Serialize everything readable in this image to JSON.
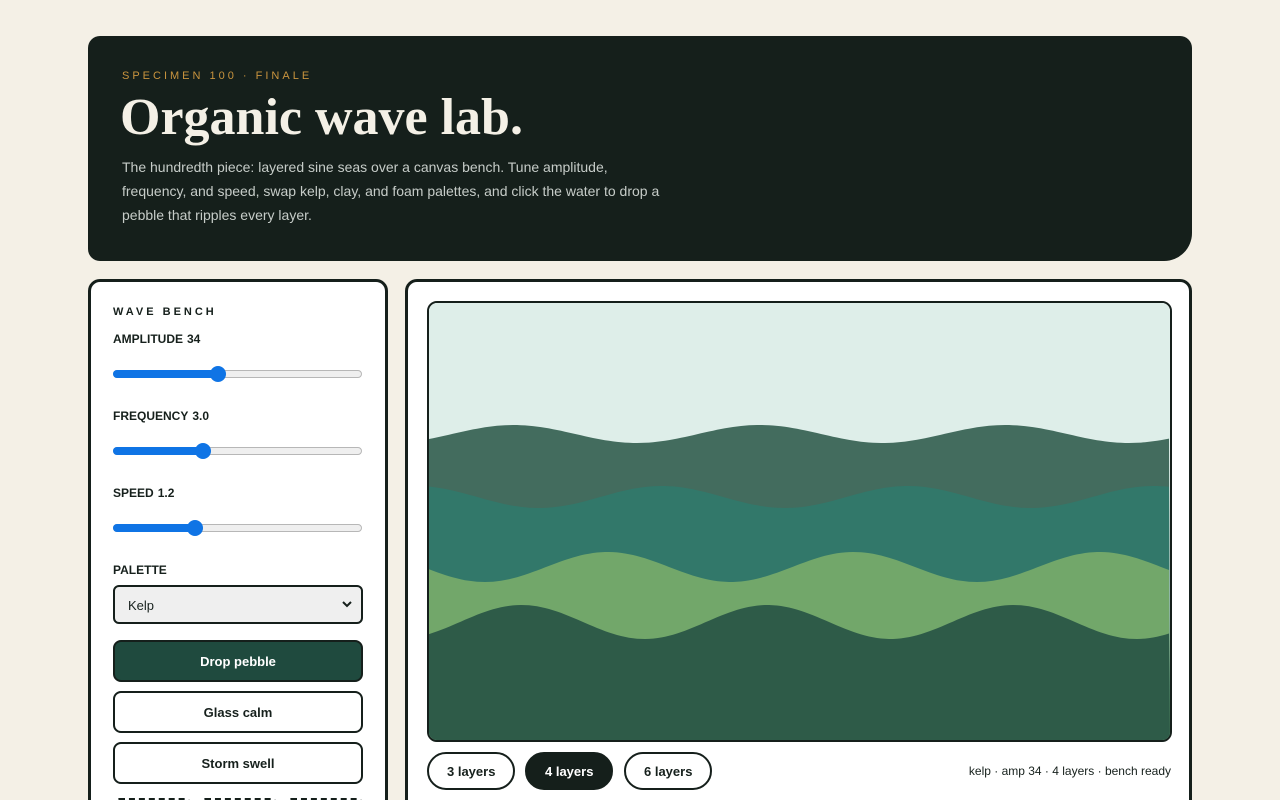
{
  "hero": {
    "kicker": "SPECIMEN 100 · FINALE",
    "title": "Organic wave lab.",
    "description": "The hundredth piece: layered sine seas over a canvas bench. Tune amplitude, frequency, and speed, swap kelp, clay, and foam palettes, and click the water to drop a pebble that ripples every layer."
  },
  "bench": {
    "title": "WAVE BENCH",
    "amplitude": {
      "label": "AMPLITUDE",
      "value": "34",
      "level": 0.42
    },
    "frequency": {
      "label": "FREQUENCY",
      "value": "3.0",
      "level": 0.36
    },
    "speed": {
      "label": "SPEED",
      "value": "1.2",
      "level": 0.33
    },
    "palette": {
      "label": "PALETTE",
      "selected": "Kelp"
    },
    "buttons": {
      "drop_pebble": "Drop pebble",
      "glass_calm": "Glass calm",
      "storm_swell": "Storm swell"
    }
  },
  "stage": {
    "layer_options": [
      {
        "label": "3 layers",
        "active": false
      },
      {
        "label": "4 layers",
        "active": true
      },
      {
        "label": "6 layers",
        "active": false
      }
    ],
    "status": "kelp · amp 34 · 4 layers · bench ready"
  },
  "colors": {
    "sky": "#deeee9",
    "layers": [
      "#436c5e",
      "#32786a",
      "#72a76a",
      "#2e5b48"
    ],
    "accent": "#c9943e",
    "dark": "#151f1b",
    "primary_button": "#1f4a3e",
    "slider": "#0f74e5"
  }
}
